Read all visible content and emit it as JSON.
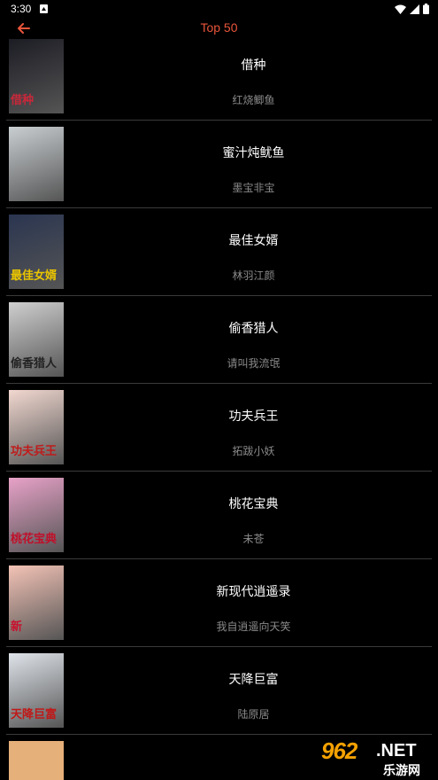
{
  "status_bar": {
    "time": "3:30"
  },
  "toolbar": {
    "title": "Top 50"
  },
  "books": [
    {
      "title": "借种",
      "author": "红烧鲫鱼",
      "cover_text": "借种",
      "cover_bg": "#1c1c24",
      "cover_fg": "#c8283a"
    },
    {
      "title": "蜜汁炖鱿鱼",
      "author": "墨宝非宝",
      "cover_text": "",
      "cover_bg": "#c9ced1",
      "cover_fg": "#555"
    },
    {
      "title": "最佳女婿",
      "author": "林羽江颜",
      "cover_text": "最佳女婿",
      "cover_bg": "#2a3550",
      "cover_fg": "#e9c400"
    },
    {
      "title": "偷香猎人",
      "author": "请叫我流氓",
      "cover_text": "偷香猎人",
      "cover_bg": "#cfcfcf",
      "cover_fg": "#222"
    },
    {
      "title": "功夫兵王",
      "author": "拓跋小妖",
      "cover_text": "功夫兵王",
      "cover_bg": "#f2d8d0",
      "cover_fg": "#c01a1a"
    },
    {
      "title": "桃花宝典",
      "author": "未苍",
      "cover_text": "桃花宝典",
      "cover_bg": "#e8a2c8",
      "cover_fg": "#c0102a"
    },
    {
      "title": "新现代逍遥录",
      "author": "我自逍遥向天笑",
      "cover_text": "新",
      "cover_bg": "#f4c3b6",
      "cover_fg": "#c8102e"
    },
    {
      "title": "天降巨富",
      "author": "陆原居",
      "cover_text": "天降巨富",
      "cover_bg": "#dfe4ea",
      "cover_fg": "#c01818"
    }
  ],
  "watermark": {
    "main": "962",
    "net": ".NET",
    "cn": "乐游网"
  }
}
